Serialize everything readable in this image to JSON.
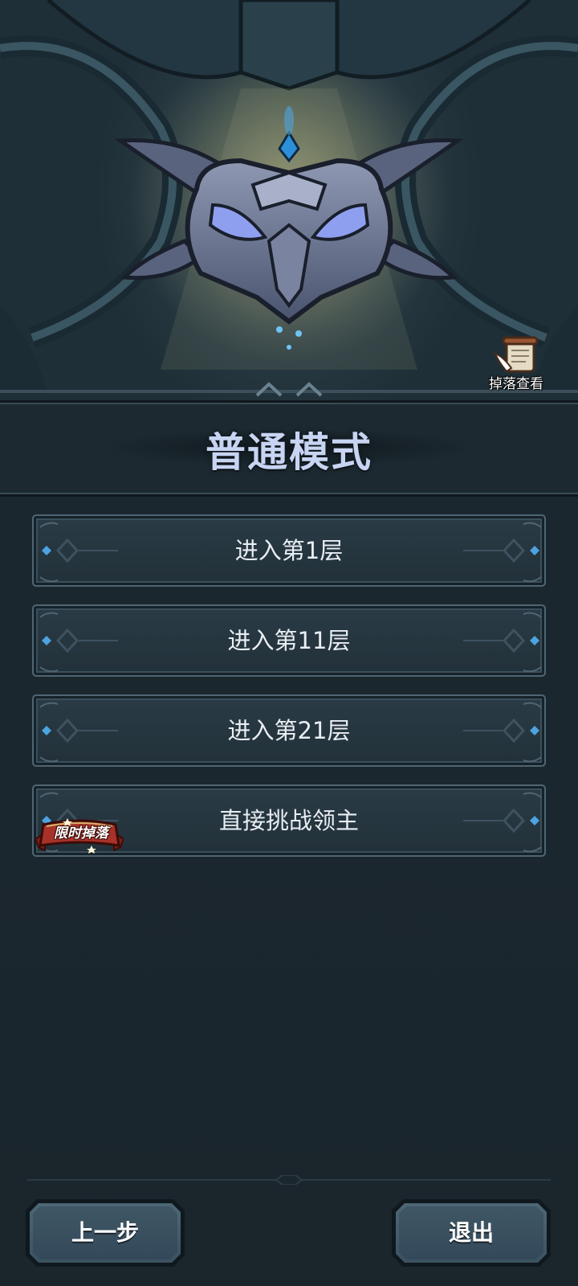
{
  "hero": {
    "drop_view_label": "掉落查看",
    "icons": [
      "boss-helmet-icon",
      "scroll-icon"
    ]
  },
  "mode": {
    "title": "普通模式"
  },
  "floors": [
    {
      "label": "进入第1层"
    },
    {
      "label": "进入第11层"
    },
    {
      "label": "进入第21层"
    },
    {
      "label": "直接挑战领主",
      "badge": "限时掉落"
    }
  ],
  "nav": {
    "back_label": "上一步",
    "exit_label": "退出"
  },
  "colors": {
    "background": "#1b272f",
    "title_text": "#c7d4f2",
    "button_fill": "#2a3b46",
    "gem_accent": "#4da3e0",
    "badge_red": "#a8322a"
  }
}
